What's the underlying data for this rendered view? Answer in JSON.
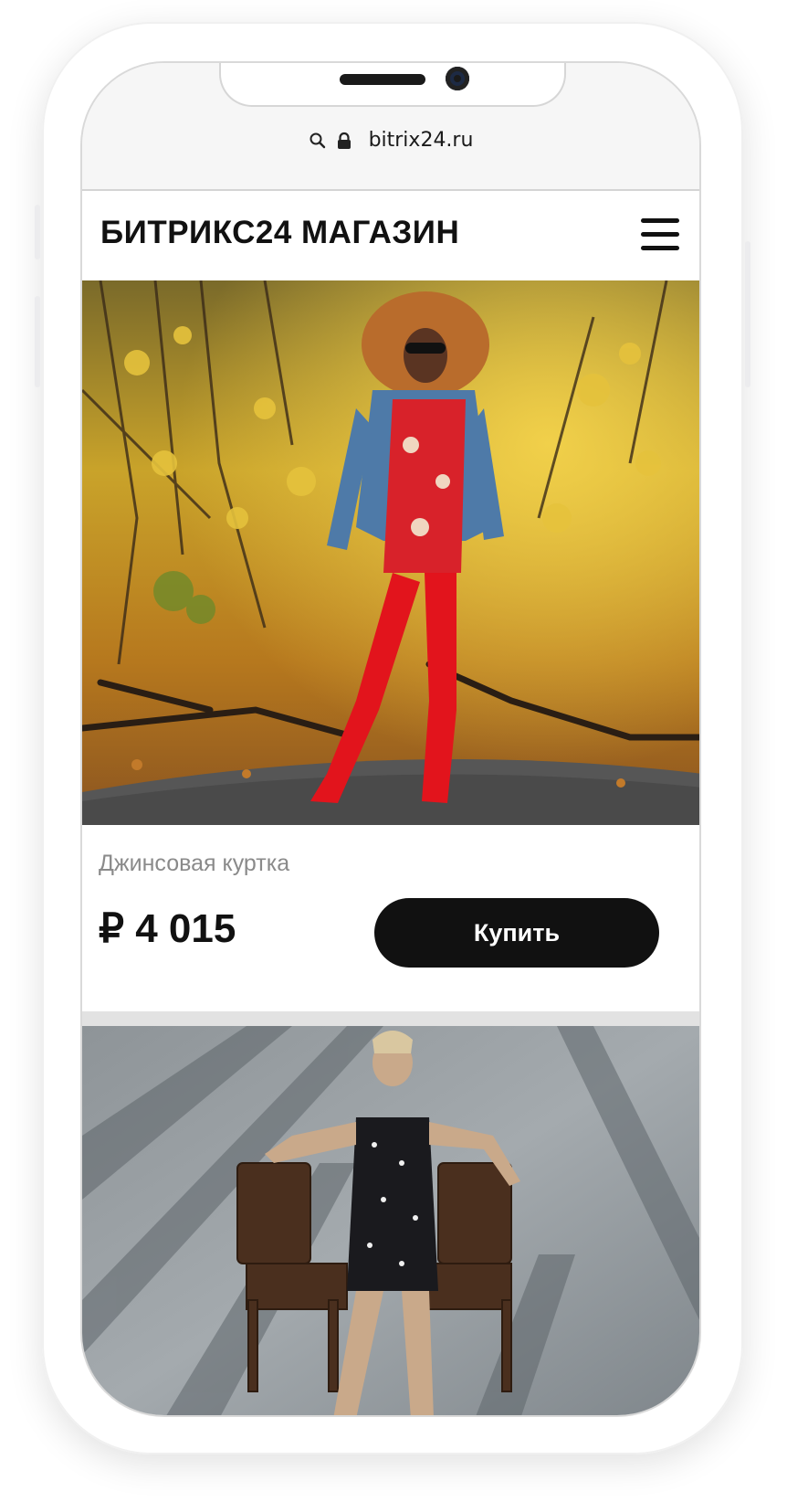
{
  "browser": {
    "url": "bitrix24.ru",
    "icons": [
      "search-icon",
      "lock-icon"
    ]
  },
  "header": {
    "brand": "БИТРИКС24 МАГАЗИН",
    "menu_icon": "hamburger-menu-icon"
  },
  "products": [
    {
      "name": "Джинсовая куртка",
      "price": "₽ 4 015",
      "buy_label": "Купить"
    }
  ],
  "colors": {
    "button_bg": "#111111",
    "button_text": "#ffffff",
    "name_text": "#8a8a8a",
    "price_text": "#111111"
  }
}
